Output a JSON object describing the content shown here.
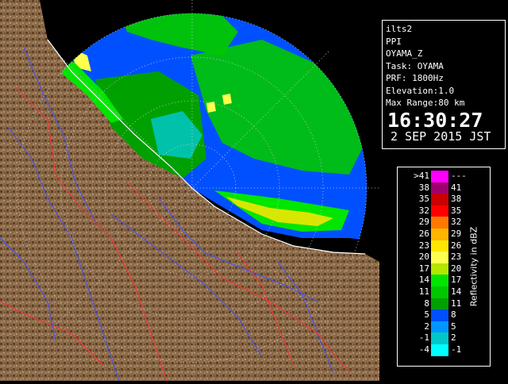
{
  "info": {
    "lines": [
      "ilts2",
      "PPI",
      "OYAMA_Z",
      "Task: OYAMA",
      "PRF: 1800Hz",
      "Elevation:1.0",
      "Max Range:80 km"
    ],
    "time": "16:30:27",
    "date": "2 SEP 2015 JST"
  },
  "legend": {
    "title": "Reflectivity in dBZ",
    "rows": [
      {
        "left": ">41",
        "right": "---",
        "color": "#ff00ff"
      },
      {
        "left": "38",
        "right": "41",
        "color": "#a0006e"
      },
      {
        "left": "35",
        "right": "38",
        "color": "#cc0000"
      },
      {
        "left": "32",
        "right": "35",
        "color": "#ff0000"
      },
      {
        "left": "29",
        "right": "32",
        "color": "#ff7800"
      },
      {
        "left": "26",
        "right": "29",
        "color": "#ffb400"
      },
      {
        "left": "23",
        "right": "26",
        "color": "#ffe600"
      },
      {
        "left": "20",
        "right": "23",
        "color": "#ffff50"
      },
      {
        "left": "17",
        "right": "20",
        "color": "#b4e600"
      },
      {
        "left": "14",
        "right": "17",
        "color": "#00e600"
      },
      {
        "left": "11",
        "right": "14",
        "color": "#00c800"
      },
      {
        "left": "8",
        "right": "11",
        "color": "#00a000"
      },
      {
        "left": "5",
        "right": "8",
        "color": "#0050ff"
      },
      {
        "left": "2",
        "right": "5",
        "color": "#0096ff"
      },
      {
        "left": "-1",
        "right": "2",
        "color": "#00c8c8"
      },
      {
        "left": "-4",
        "right": "-1",
        "color": "#00ffff"
      }
    ]
  },
  "map": {
    "radar_site": "OYAMA",
    "colors": {
      "sea_echo": "#0050ff",
      "land": "#8b6a48",
      "coast": "#ffffff",
      "rivers": "#4050ff",
      "roads": "#ff3030"
    }
  }
}
